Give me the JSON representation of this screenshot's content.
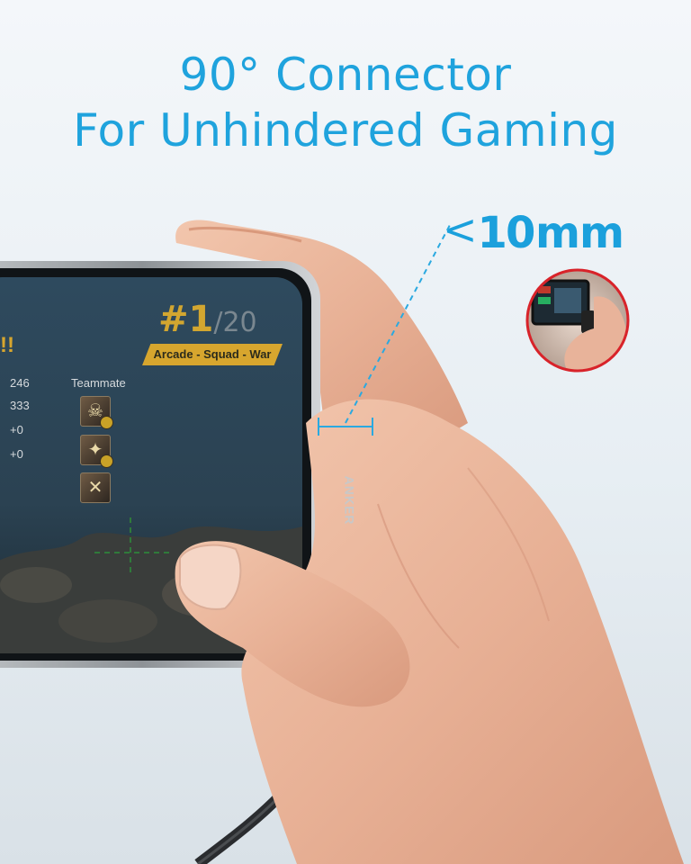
{
  "headline": {
    "line1": "90° Connector",
    "line2": "For Unhindered Gaming"
  },
  "measurement": {
    "symbol": "<",
    "value": "10",
    "unit": "mm"
  },
  "game_hud": {
    "rank": "#1",
    "total": "/20",
    "mode": "Arcade - Squad - War",
    "exclamation": "!!",
    "teammate_label": "Teammate",
    "stats": [
      "246",
      "333",
      "+0",
      "+0"
    ]
  },
  "cable_brand": "ANKER",
  "colors": {
    "accent_blue": "#1fa3dd",
    "hud_gold": "#d7a62e",
    "inset_ring": "#d8232a"
  }
}
